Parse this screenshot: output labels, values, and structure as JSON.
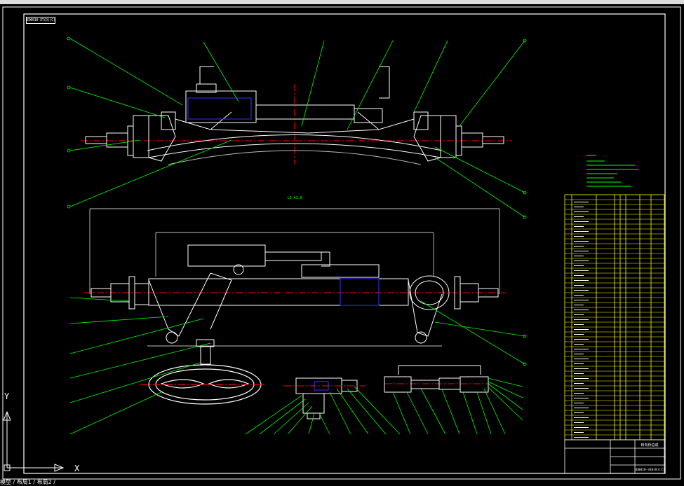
{
  "drawing": {
    "stamp_code": "ED0010-XT(D)(C)",
    "section_caption": "LS-A1.0",
    "titleblock": {
      "title": "转向桥总成",
      "code": "ED0010-340(B)(C)"
    }
  },
  "colors": {
    "background": "#000000",
    "outline": "#ffffff",
    "leader": "#00ff00",
    "centerline": "#ff0000",
    "hidden": "#3333ff",
    "table": "#ffff00",
    "note": "#00ff00"
  },
  "ucs": {
    "x_label": "X",
    "y_label": "Y"
  },
  "layout_tabs": "模型 / 布局1 / 布局2 /"
}
